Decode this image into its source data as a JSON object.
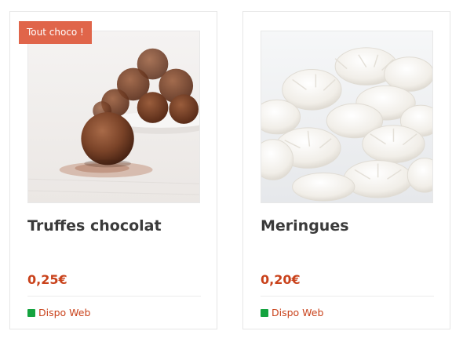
{
  "products": [
    {
      "badge": "Tout choco !",
      "name": "Truffes chocolat",
      "price": "0,25€",
      "availability": "Dispo Web",
      "image": "chocolate-truffles-photo"
    },
    {
      "badge": null,
      "name": "Meringues",
      "price": "0,20€",
      "availability": "Dispo Web",
      "image": "meringues-photo"
    }
  ],
  "colors": {
    "badge_bg": "#e0654a",
    "price": "#c9421b",
    "availability_text": "#c9421b",
    "availability_icon": "#14a33f",
    "title": "#3a3a3a"
  },
  "icons": {
    "availability": "green-square-status-icon"
  }
}
